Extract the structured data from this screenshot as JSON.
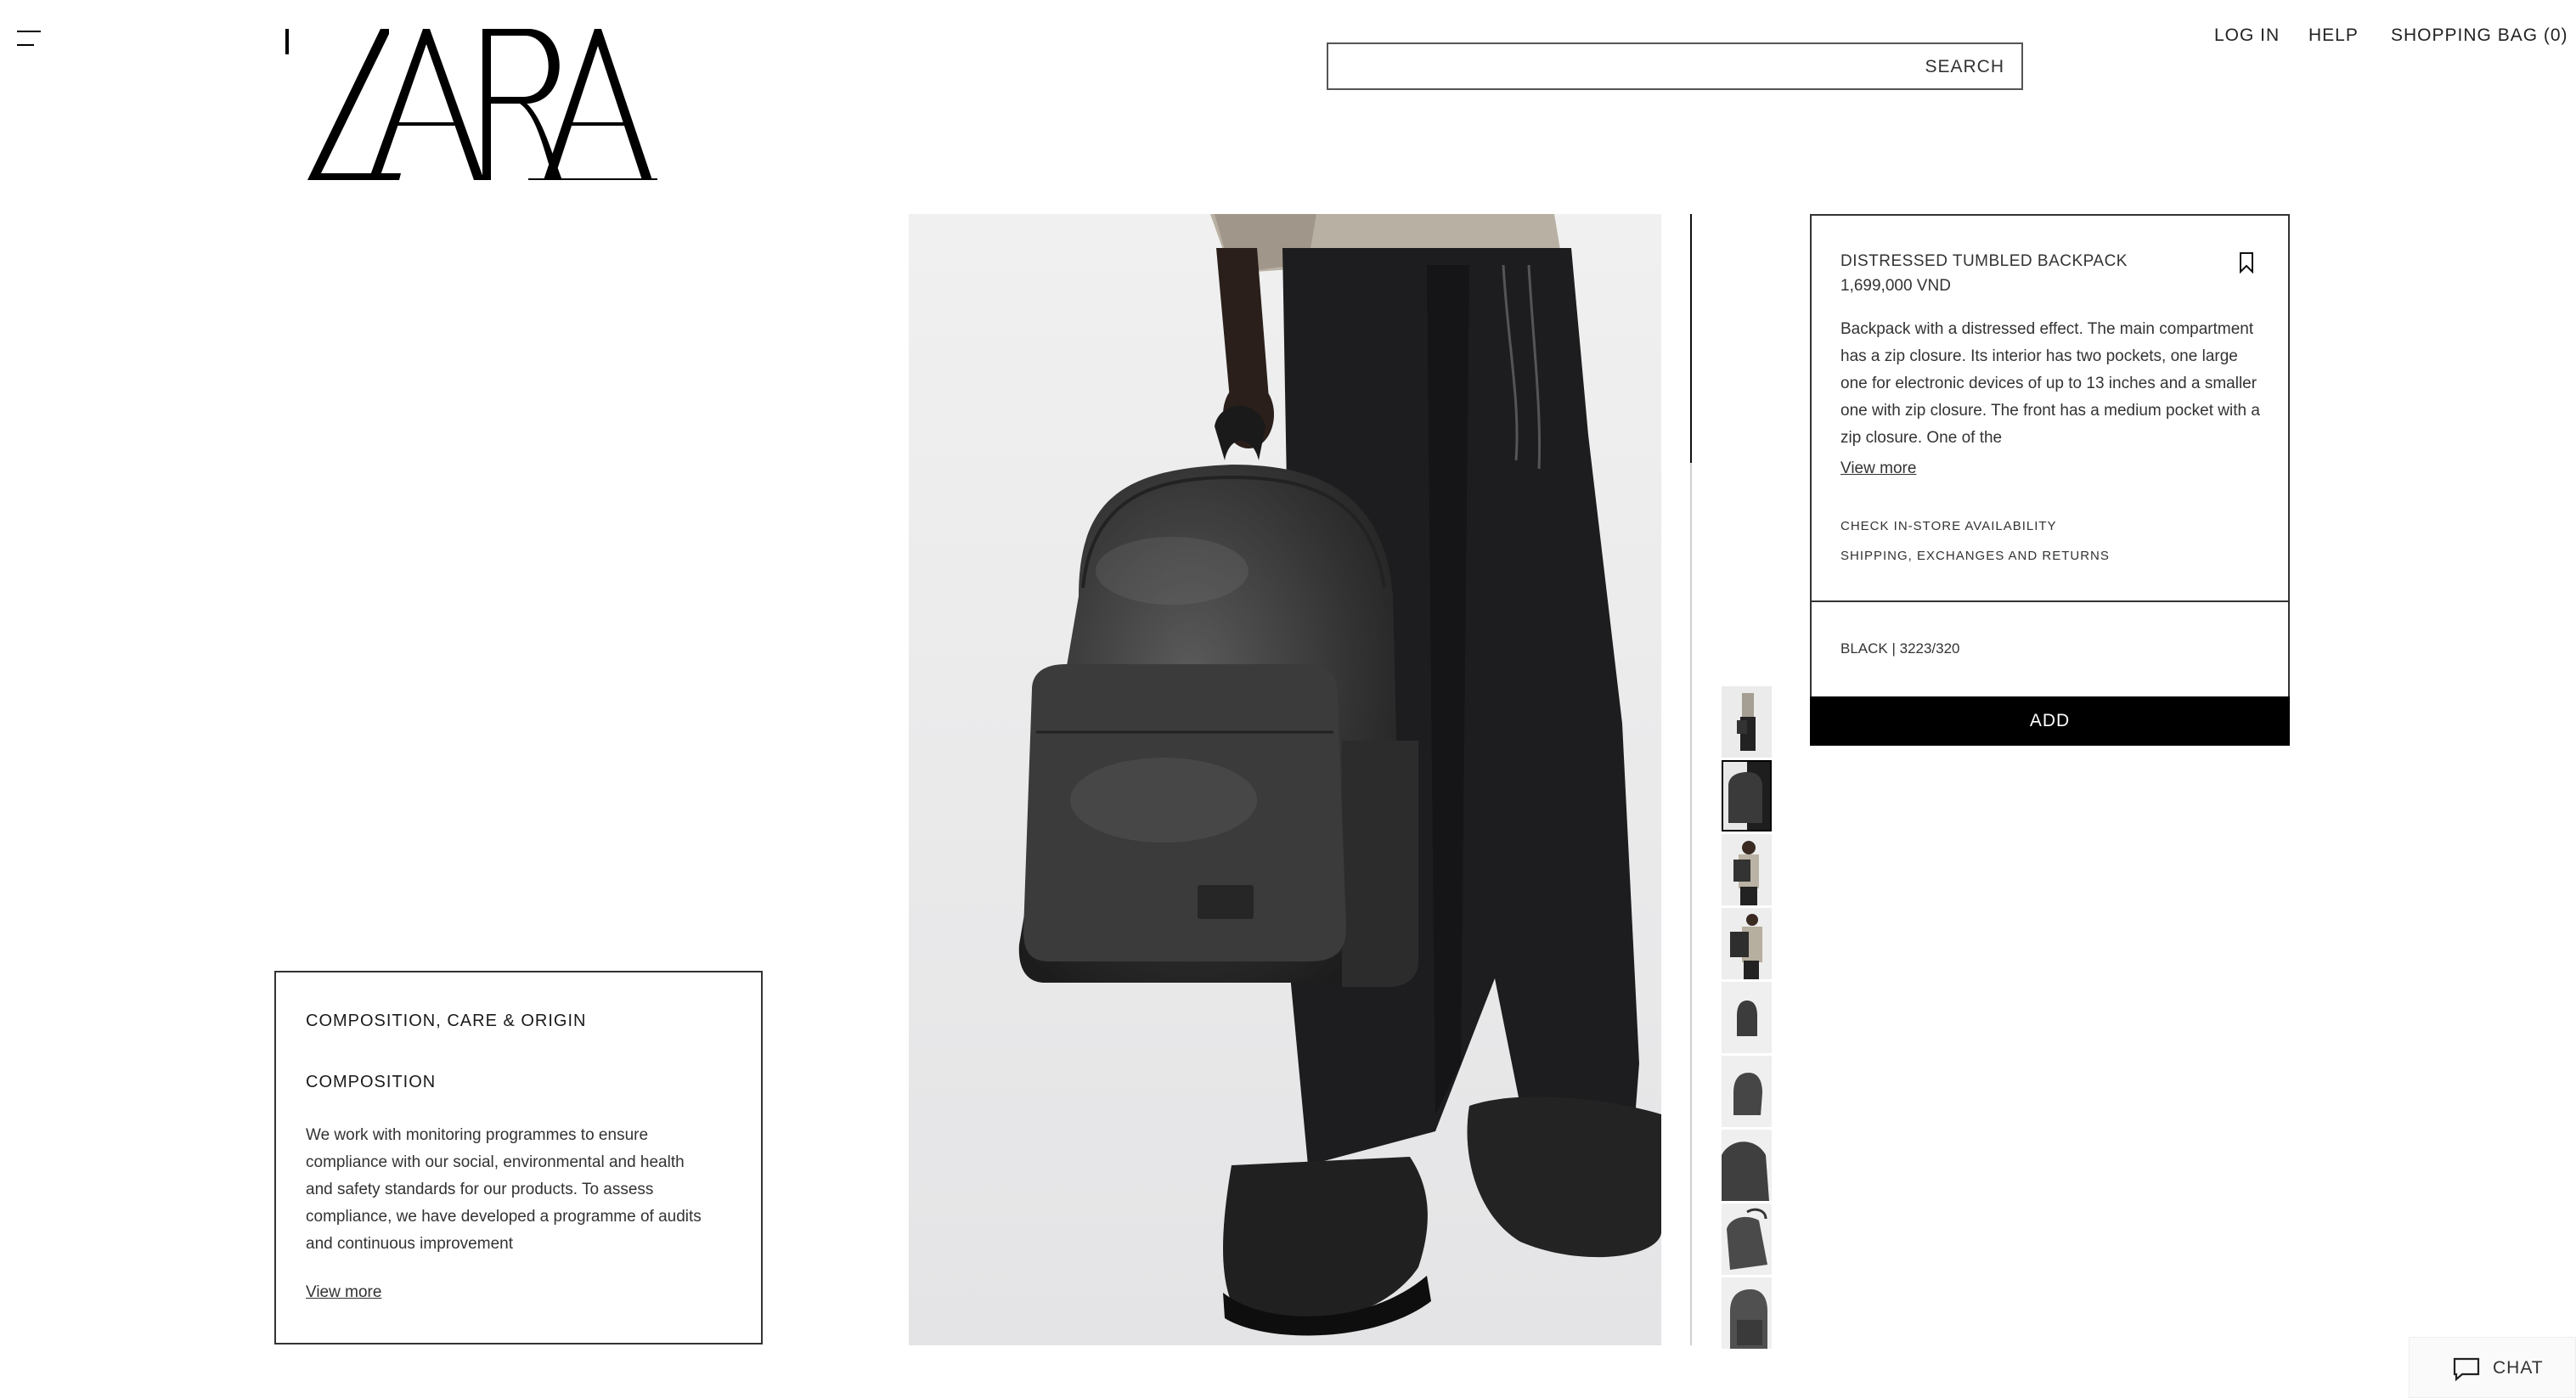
{
  "header": {
    "brand": "ZARA",
    "search_label": "SEARCH",
    "search_value": "",
    "nav": [
      "LOG IN",
      "HELP",
      "SHOPPING BAG (0)"
    ]
  },
  "composition": {
    "title": "COMPOSITION, CARE & ORIGIN",
    "subtitle": "COMPOSITION",
    "body": "We work with monitoring programmes to ensure compliance with our social, environmental and health and safety standards for our products. To assess compliance, we have developed a programme of audits and continuous improvement",
    "view_more": "View more"
  },
  "product": {
    "name": "DISTRESSED TUMBLED BACKPACK",
    "price": "1,699,000 VND",
    "description": "Backpack with a distressed effect. The main compartment has a zip closure. Its interior has two pockets, one large one for electronic devices of up to 13 inches and a smaller one with zip closure. The front has a medium pocket with a zip closure. One of the",
    "view_more": "View more",
    "check_store": "CHECK IN-STORE AVAILABILITY",
    "shipping": "SHIPPING, EXCHANGES AND RETURNS",
    "variant": "BLACK | 3223/320",
    "add_label": "ADD"
  },
  "gallery": {
    "thumbnail_count": 9,
    "selected_index": 1,
    "scroll_fraction": 0.22
  },
  "chat": {
    "label": "CHAT"
  },
  "colors": {
    "accent": "#000000",
    "border": "#333333",
    "background": "#ffffff"
  }
}
